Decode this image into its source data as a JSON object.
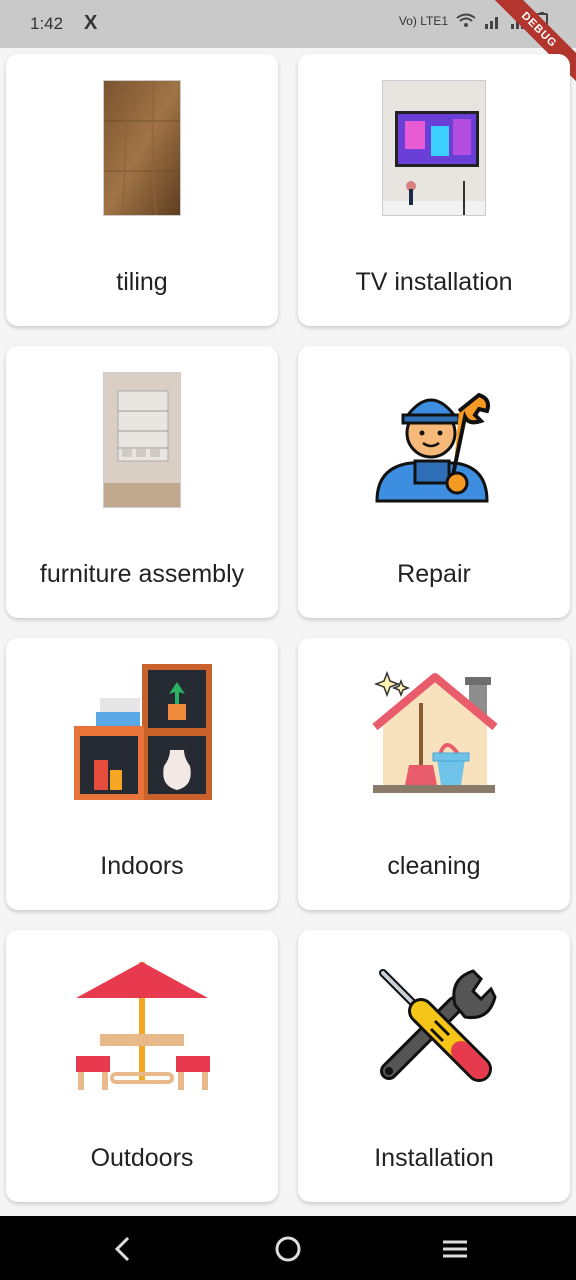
{
  "status": {
    "time": "1:42",
    "x_logo": "X",
    "network": "Vo) LTE1",
    "debug_banner": "DEBUG"
  },
  "categories": [
    {
      "label": "tiling",
      "icon": "wood-floor-photo"
    },
    {
      "label": "TV installation",
      "icon": "tv-wall-photo"
    },
    {
      "label": "furniture assembly",
      "icon": "wall-shelf-photo"
    },
    {
      "label": "Repair",
      "icon": "repairman-icon"
    },
    {
      "label": "Indoors",
      "icon": "indoor-shelf-icon"
    },
    {
      "label": "cleaning",
      "icon": "house-cleaning-icon"
    },
    {
      "label": "Outdoors",
      "icon": "outdoor-table-umbrella-icon"
    },
    {
      "label": "Installation",
      "icon": "wrench-screwdriver-icon"
    }
  ],
  "colors": {
    "statusbar": "#c9c9c9",
    "card": "#ffffff",
    "navbar": "#000000"
  }
}
